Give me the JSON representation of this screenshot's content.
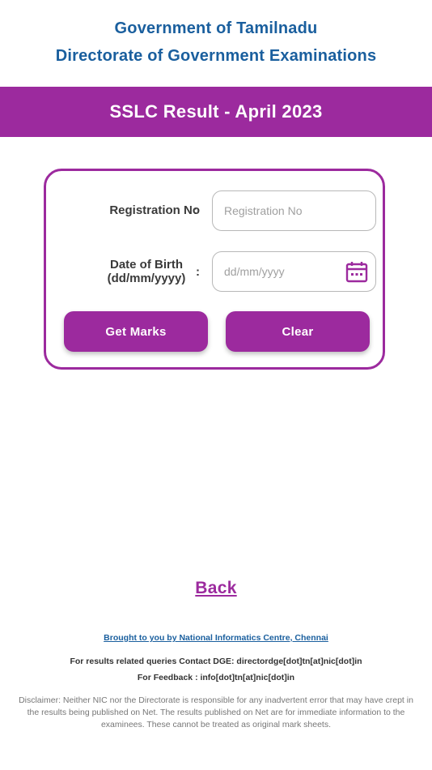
{
  "header": {
    "line1": "Government of Tamilnadu",
    "line2": "Directorate of Government Examinations"
  },
  "banner": {
    "title": "SSLC Result - April 2023"
  },
  "form": {
    "registration_label": "Registration No",
    "colon": ":",
    "registration_placeholder": "Registration No",
    "dob_label_line1": "Date of Birth",
    "dob_label_line2": "(dd/mm/yyyy)",
    "dob_placeholder": "dd/mm/yyyy",
    "get_marks_label": "Get Marks",
    "clear_label": "Clear"
  },
  "back_label": "Back",
  "footer": {
    "credit": "Brought to you by National Informatics Centre, Chennai",
    "contact": "For results related queries Contact DGE:  directordge[dot]tn[at]nic[dot]in",
    "feedback": "For Feedback : info[dot]tn[at]nic[dot]in",
    "disclaimer": "Disclaimer: Neither NIC nor the Directorate is responsible for any inadvertent error that may have crept in the results being published on Net. The results published on Net are for immediate information to the examinees. These cannot be treated as original mark sheets."
  },
  "colors": {
    "accent": "#9c2a9e",
    "header_blue": "#1a5f9e"
  },
  "icons": {
    "date_picker": "calendar-icon"
  }
}
